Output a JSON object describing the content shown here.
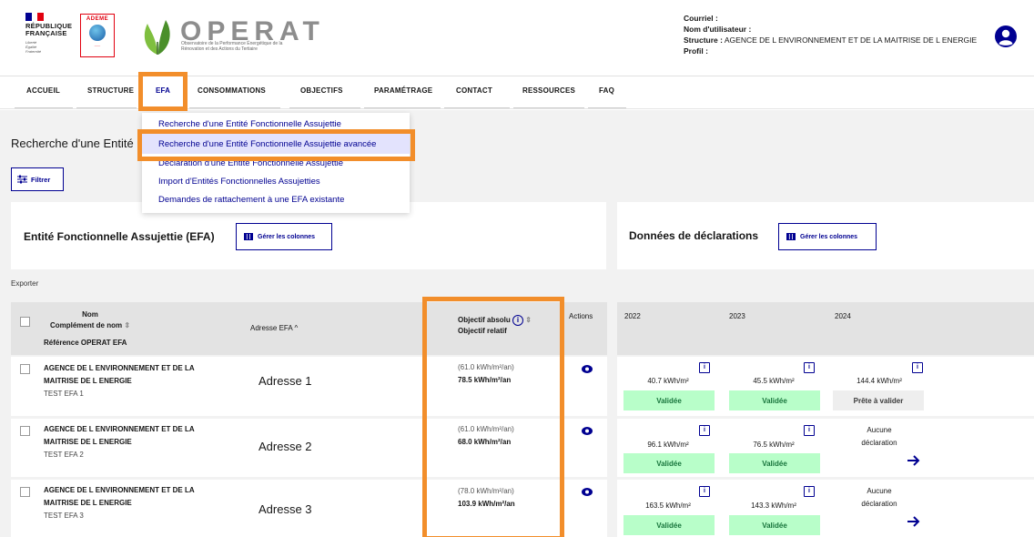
{
  "header": {
    "republique": "RÉPUBLIQUE\nFRANÇAISE",
    "devise": "Liberté\nÉgalité\nFraternité",
    "ademe": "ADEME",
    "brand": "OPERAT",
    "tagline": "Observatoire de la Performance Énergétique de la Rénovation et des Actions du Tertiaire",
    "user": {
      "courriel_label": "Courriel :",
      "nom_label": "Nom d'utilisateur :",
      "structure_label": "Structure :",
      "structure_value": "AGENCE DE L ENVIRONNEMENT ET DE LA MAITRISE DE L ENERGIE",
      "profil_label": "Profil :"
    }
  },
  "nav": {
    "items": [
      "ACCUEIL",
      "STRUCTURE",
      "EFA",
      "CONSOMMATIONS",
      "OBJECTIFS",
      "PARAMÉTRAGE",
      "CONTACT",
      "RESSOURCES",
      "FAQ"
    ]
  },
  "menu": {
    "items": [
      "Recherche d'une Entité Fonctionnelle Assujettie",
      "Recherche d'une Entité Fonctionnelle Assujettie avancée",
      "Déclaration d'une Entité Fonctionnelle Assujettie",
      "Import d'Entités Fonctionnelles Assujetties",
      "Demandes de rattachement à une EFA existante"
    ]
  },
  "page": {
    "title": "Recherche d'une Entité",
    "filter": "Filtrer",
    "exporter": "Exporter"
  },
  "panels": {
    "efa_title": "Entité Fonctionnelle Assujettie (EFA)",
    "decl_title": "Données de déclarations",
    "cols_btn": "Gérer les colonnes"
  },
  "table": {
    "headers": {
      "nom": "Nom",
      "complement": "Complément de nom",
      "reference": "Référence OPERAT EFA",
      "adresse": "Adresse EFA ^",
      "obj_abs": "Objectif absolu",
      "obj_rel": "Objectif relatif",
      "actions": "Actions",
      "years": [
        "2022",
        "2023",
        "2024"
      ]
    },
    "rows": [
      {
        "nom1": "AGENCE DE L ENVIRONNEMENT ET DE LA",
        "nom2": "MAITRISE DE L ENERGIE",
        "ref": "TEST EFA 1",
        "adresse": "Adresse 1",
        "obj_abs": "(61.0 kWh/m²/an)",
        "obj_rel": "78.5 kWh/m²/an",
        "decl": [
          {
            "value": "40.7 kWh/m²",
            "status": "Validée"
          },
          {
            "value": "45.5 kWh/m²",
            "status": "Validée"
          },
          {
            "value": "144.4 kWh/m²",
            "status": "Prête à valider"
          }
        ]
      },
      {
        "nom1": "AGENCE DE L ENVIRONNEMENT ET DE LA",
        "nom2": "MAITRISE DE L ENERGIE",
        "ref": "TEST EFA 2",
        "adresse": "Adresse 2",
        "obj_abs": "(61.0 kWh/m²/an)",
        "obj_rel": "68.0 kWh/m²/an",
        "decl": [
          {
            "value": "96.1 kWh/m²",
            "status": "Validée"
          },
          {
            "value": "76.5 kWh/m²",
            "status": "Validée"
          }
        ],
        "none_label": "Aucune\ndéclaration"
      },
      {
        "nom1": "AGENCE DE L ENVIRONNEMENT ET DE LA",
        "nom2": "MAITRISE DE L ENERGIE",
        "ref": "TEST EFA 3",
        "adresse": "Adresse 3",
        "obj_abs": "(78.0 kWh/m²/an)",
        "obj_rel": "103.9 kWh/m²/an",
        "decl": [
          {
            "value": "163.5 kWh/m²",
            "status": "Validée"
          },
          {
            "value": "143.3 kWh/m²",
            "status": "Validée"
          }
        ],
        "none_label": "Aucune\ndéclaration"
      }
    ]
  },
  "colors": {
    "accent": "#000091",
    "highlight": "#f28e2b",
    "valid_bg": "#b8fec9",
    "valid_text": "#18753c"
  },
  "icons": {
    "user": "user-circle-icon",
    "filter": "sliders-icon",
    "columns": "columns-icon",
    "info": "info-icon",
    "eye": "eye-icon",
    "doc": "document-icon",
    "arrow": "arrow-right-icon"
  }
}
